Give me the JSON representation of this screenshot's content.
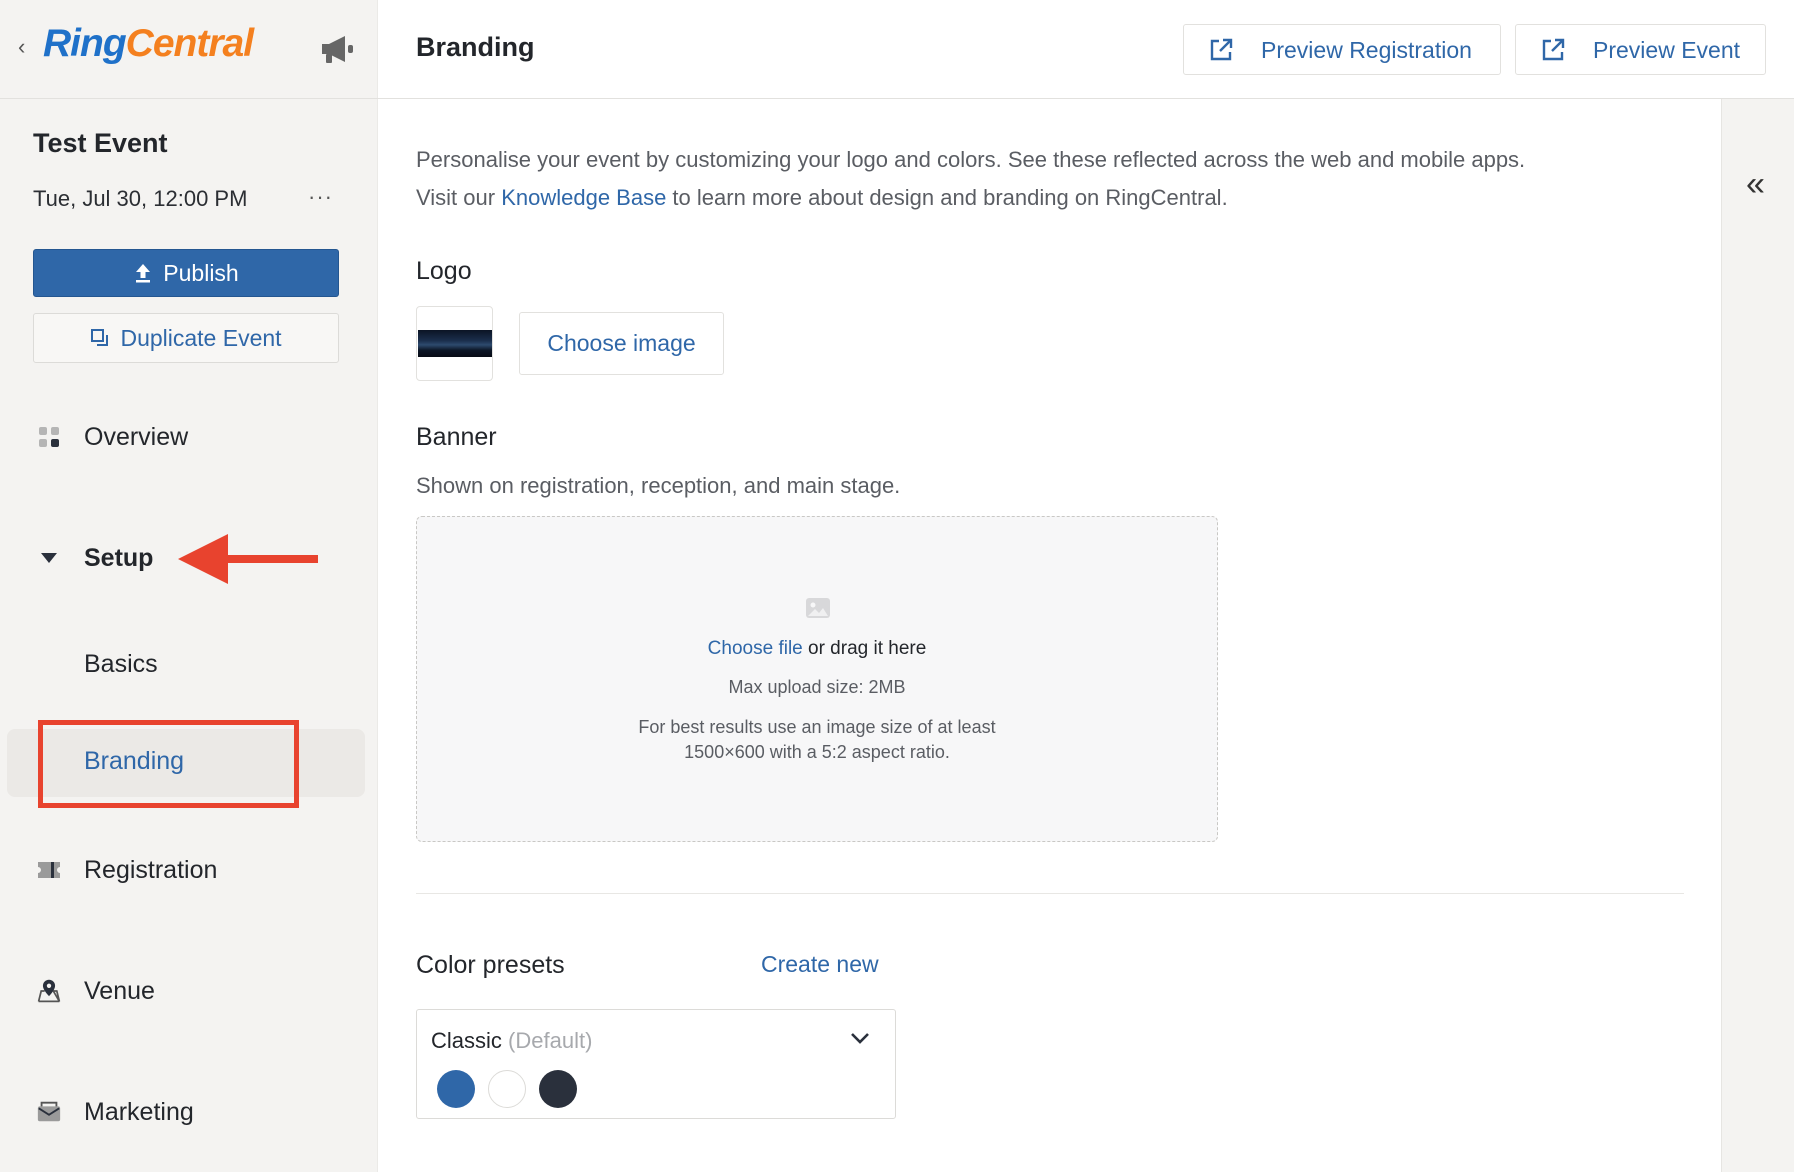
{
  "sidebar": {
    "logo": {
      "part1": "Ring",
      "part2": "Central"
    },
    "event_title": "Test Event",
    "event_date": "Tue, Jul 30, 12:00 PM",
    "more": "···",
    "publish_label": "Publish",
    "duplicate_label": "Duplicate Event",
    "nav": {
      "overview": "Overview",
      "setup": "Setup",
      "basics": "Basics",
      "branding": "Branding",
      "registration": "Registration",
      "venue": "Venue",
      "marketing": "Marketing"
    }
  },
  "header": {
    "title": "Branding",
    "preview_registration": "Preview Registration",
    "preview_event": "Preview Event"
  },
  "main": {
    "intro_line1": "Personalise your event by customizing your logo and colors. See these reflected across the web and mobile apps.",
    "intro_line2_pre": "Visit our ",
    "intro_link": "Knowledge Base",
    "intro_line2_post": " to learn more about design and branding on RingCentral.",
    "logo_heading": "Logo",
    "choose_image": "Choose image",
    "banner_heading": "Banner",
    "banner_subtitle": "Shown on registration, reception, and main stage.",
    "dropzone": {
      "choose_file": "Choose file",
      "drag_text": " or drag it here",
      "max_size": "Max upload size: 2MB",
      "hint_line1": "For best results use an image size of at least",
      "hint_line2": "1500×600 with a 5:2 aspect ratio."
    },
    "color_presets_heading": "Color presets",
    "create_new": "Create new",
    "preset": {
      "name": "Classic",
      "tag": "(Default)",
      "swatches": [
        "#2f67a8",
        "#ffffff",
        "#2a303c"
      ]
    }
  },
  "colors": {
    "accent": "#2f67a8",
    "annotation": "#e8432e",
    "logo_blue": "#1f71c9",
    "logo_orange": "#f4801f"
  }
}
